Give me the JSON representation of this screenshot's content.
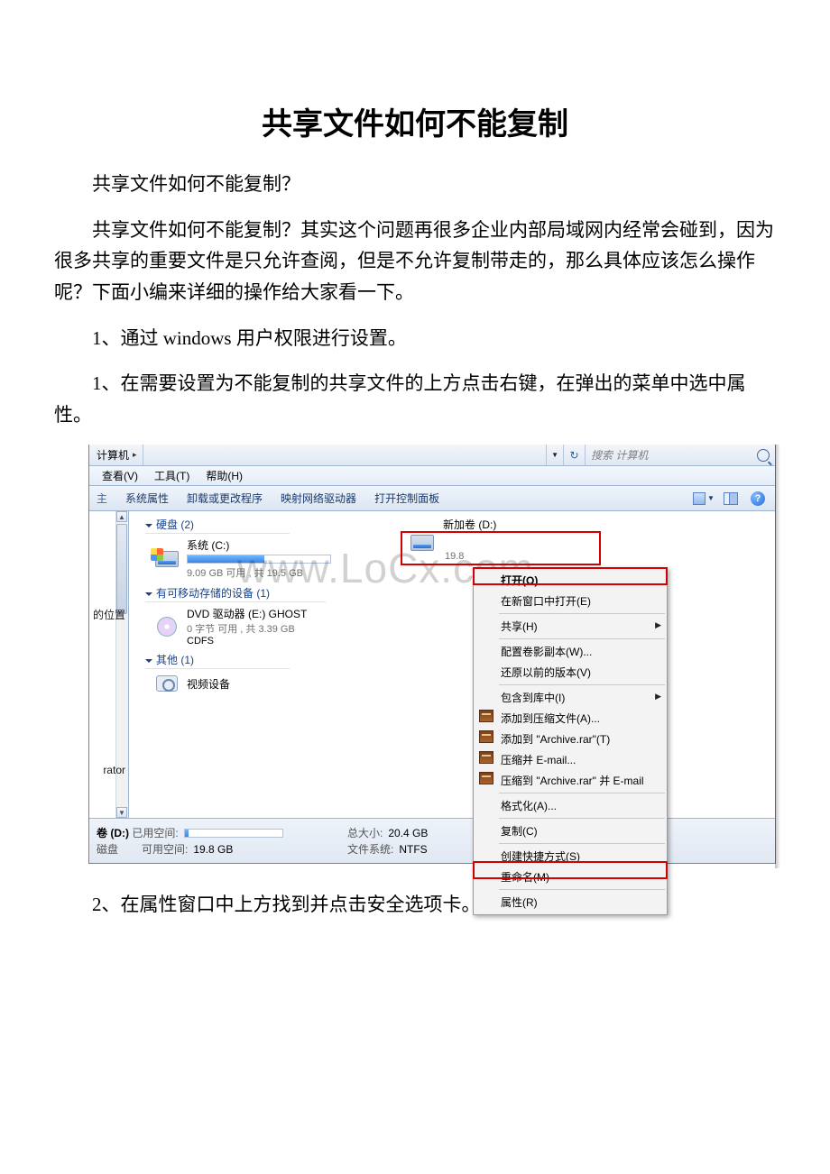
{
  "document": {
    "title": "共享文件如何不能复制",
    "intro_short": "共享文件如何不能复制？",
    "intro_long": "共享文件如何不能复制？其实这个问题再很多企业内部局域网内经常会碰到，因为很多共享的重要文件是只允许查阅，但是不允许复制带走的，那么具体应该怎么操作呢？下面小编来详细的操作给大家看一下。",
    "step1_heading": "1、通过 windows 用户权限进行设置。",
    "step1_body": "1、在需要设置为不能复制的共享文件的上方点击右键，在弹出的菜单中选中属性。",
    "step2": "2、在属性窗口中上方找到并点击安全选项卡。"
  },
  "explorer": {
    "address": {
      "root": "计算机",
      "arrow": "▸",
      "search_placeholder": "搜索 计算机"
    },
    "menu": {
      "view": "查看(V)",
      "tools": "工具(T)",
      "help": "帮助(H)"
    },
    "cmd": {
      "left_cut": "主",
      "sysprops": "系统属性",
      "uninstall": "卸载或更改程序",
      "mapnet": "映射网络驱动器",
      "ctrlpanel": "打开控制面板",
      "help_glyph": "?"
    },
    "nav": {
      "cut_label_1": "的位置",
      "cut_label_2": "rator"
    },
    "groups": {
      "hdd_header": "硬盘 (2)",
      "removable_header": "有可移动存储的设备 (1)",
      "other_header": "其他 (1)"
    },
    "drive_c": {
      "name": "系统 (C:)",
      "info": "9.09 GB 可用 , 共 19.5 GB",
      "fill_pct": 54
    },
    "drive_d": {
      "name": "新加卷 (D:)",
      "partial": "19.8"
    },
    "dvd": {
      "name": "DVD 驱动器 (E:) GHOST",
      "info": "0 字节 可用 , 共 3.39 GB",
      "fs": "CDFS"
    },
    "video": {
      "name": "视频设备"
    },
    "details": {
      "title": "卷 (D:)",
      "used_label": "已用空间:",
      "type": "磁盘",
      "free_label": "可用空间:",
      "free_val": "19.8 GB",
      "size_label": "总大小:",
      "size_val": "20.4 GB",
      "fs_label": "文件系统:",
      "fs_val": "NTFS"
    },
    "watermark": "www.LoCx.com"
  },
  "context_menu": {
    "open": "打开(O)",
    "newwin": "在新窗口中打开(E)",
    "share": "共享(H)",
    "shadow": "配置卷影副本(W)...",
    "prev": "还原以前的版本(V)",
    "lib": "包含到库中(I)",
    "rar_add": "添加到压缩文件(A)...",
    "rar_to": "添加到 \"Archive.rar\"(T)",
    "rar_mail": "压缩并 E-mail...",
    "rar_both": "压缩到 \"Archive.rar\" 并 E-mail",
    "format": "格式化(A)...",
    "copy": "复制(C)",
    "shortcut": "创建快捷方式(S)",
    "rename": "重命名(M)",
    "props": "属性(R)"
  }
}
